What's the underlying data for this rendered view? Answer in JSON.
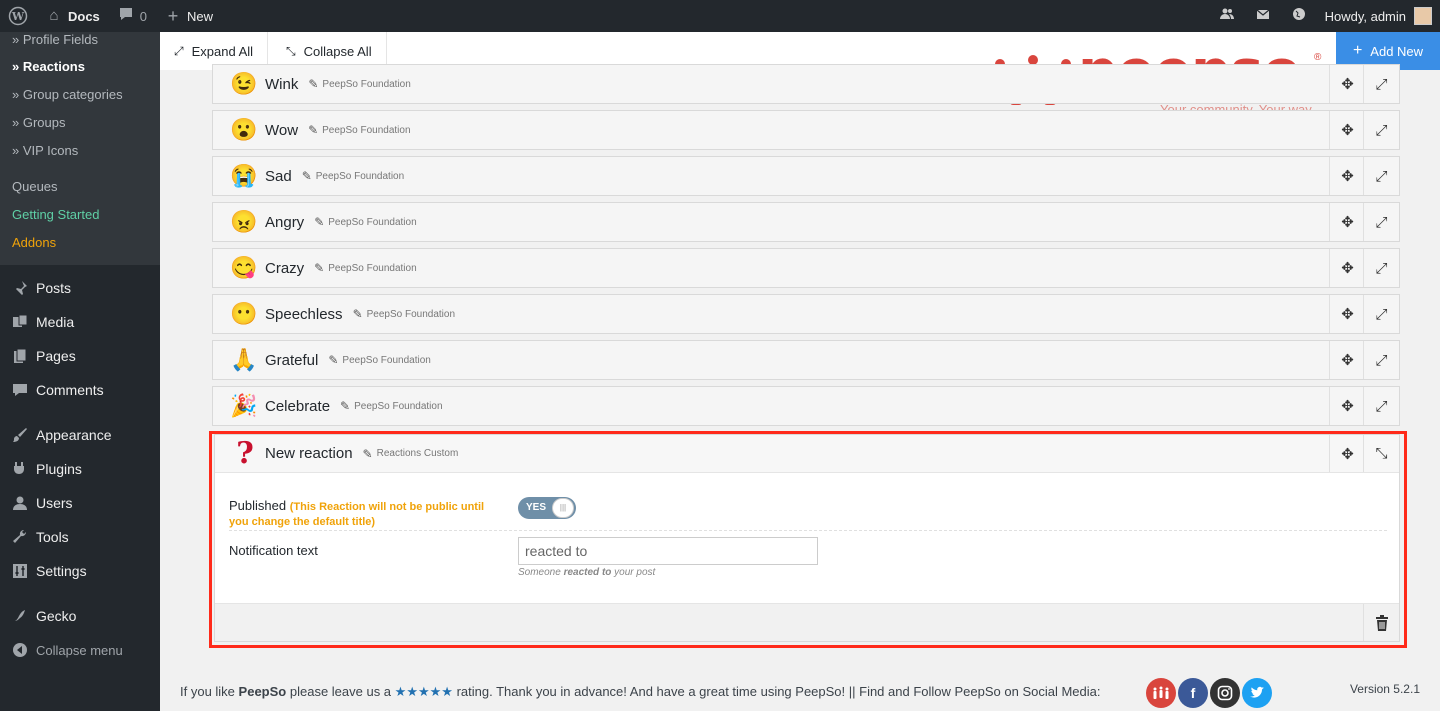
{
  "adminbar": {
    "site_name": "Docs",
    "comments_count": "0",
    "new_label": "New",
    "howdy": "Howdy, admin"
  },
  "sidebar": {
    "submenu": [
      {
        "label": "» Profile Fields",
        "style": "normal"
      },
      {
        "label": "» Reactions",
        "style": "active"
      },
      {
        "label": "» Group categories",
        "style": "normal"
      },
      {
        "label": "» Groups",
        "style": "normal"
      },
      {
        "label": "» VIP Icons",
        "style": "normal"
      },
      {
        "label": "Queues",
        "style": "normal"
      },
      {
        "label": "Getting Started",
        "style": "green"
      },
      {
        "label": "Addons",
        "style": "orange"
      }
    ],
    "menu": [
      {
        "label": "Posts",
        "icon": "pin-icon"
      },
      {
        "label": "Media",
        "icon": "media-icon"
      },
      {
        "label": "Pages",
        "icon": "pages-icon"
      },
      {
        "label": "Comments",
        "icon": "comments-icon"
      },
      {
        "label": "Appearance",
        "icon": "brush-icon"
      },
      {
        "label": "Plugins",
        "icon": "plugin-icon"
      },
      {
        "label": "Users",
        "icon": "user-icon"
      },
      {
        "label": "Tools",
        "icon": "wrench-icon"
      },
      {
        "label": "Settings",
        "icon": "settings-icon"
      },
      {
        "label": "Gecko",
        "icon": "gecko-icon"
      }
    ],
    "collapse_label": "Collapse menu"
  },
  "toolbar": {
    "expand_all": "Expand All",
    "collapse_all": "Collapse All",
    "add_new": "Add New"
  },
  "logo": {
    "word": "peepso",
    "tagline": "Your community. Your way.",
    "reg": "®"
  },
  "reactions": [
    {
      "name": "Wink",
      "author": "PeepSo Foundation",
      "emoji": "😉"
    },
    {
      "name": "Wow",
      "author": "PeepSo Foundation",
      "emoji": "😮"
    },
    {
      "name": "Sad",
      "author": "PeepSo Foundation",
      "emoji": "😭"
    },
    {
      "name": "Angry",
      "author": "PeepSo Foundation",
      "emoji": "😠"
    },
    {
      "name": "Crazy",
      "author": "PeepSo Foundation",
      "emoji": "😋"
    },
    {
      "name": "Speechless",
      "author": "PeepSo Foundation",
      "emoji": "😶"
    },
    {
      "name": "Grateful",
      "author": "PeepSo Foundation",
      "emoji": "🙏"
    },
    {
      "name": "Celebrate",
      "author": "PeepSo Foundation",
      "emoji": "🎉"
    }
  ],
  "new_reaction": {
    "name": "New reaction",
    "author": "Reactions Custom",
    "published_label": "Published",
    "published_warning": "(This Reaction will not be public until you change the default title)",
    "toggle_value": "YES",
    "notification_label": "Notification text",
    "notification_value": "reacted to",
    "help_prefix": "Someone",
    "help_bold": "reacted to",
    "help_suffix": "your post"
  },
  "footer": {
    "text_prefix": "If you like",
    "brand": "PeepSo",
    "text_mid": "please leave us a",
    "stars": "★★★★★",
    "text_suffix": "rating. Thank you in advance! And have a great time using PeepSo! || Find and Follow PeepSo on Social Media:",
    "version": "Version 5.2.1"
  },
  "colors": {
    "accent": "#3a8ee6",
    "brand": "#d9453d",
    "highlight": "#ff2a1a",
    "warning": "#f0a30a",
    "green": "#5fd0a6"
  }
}
